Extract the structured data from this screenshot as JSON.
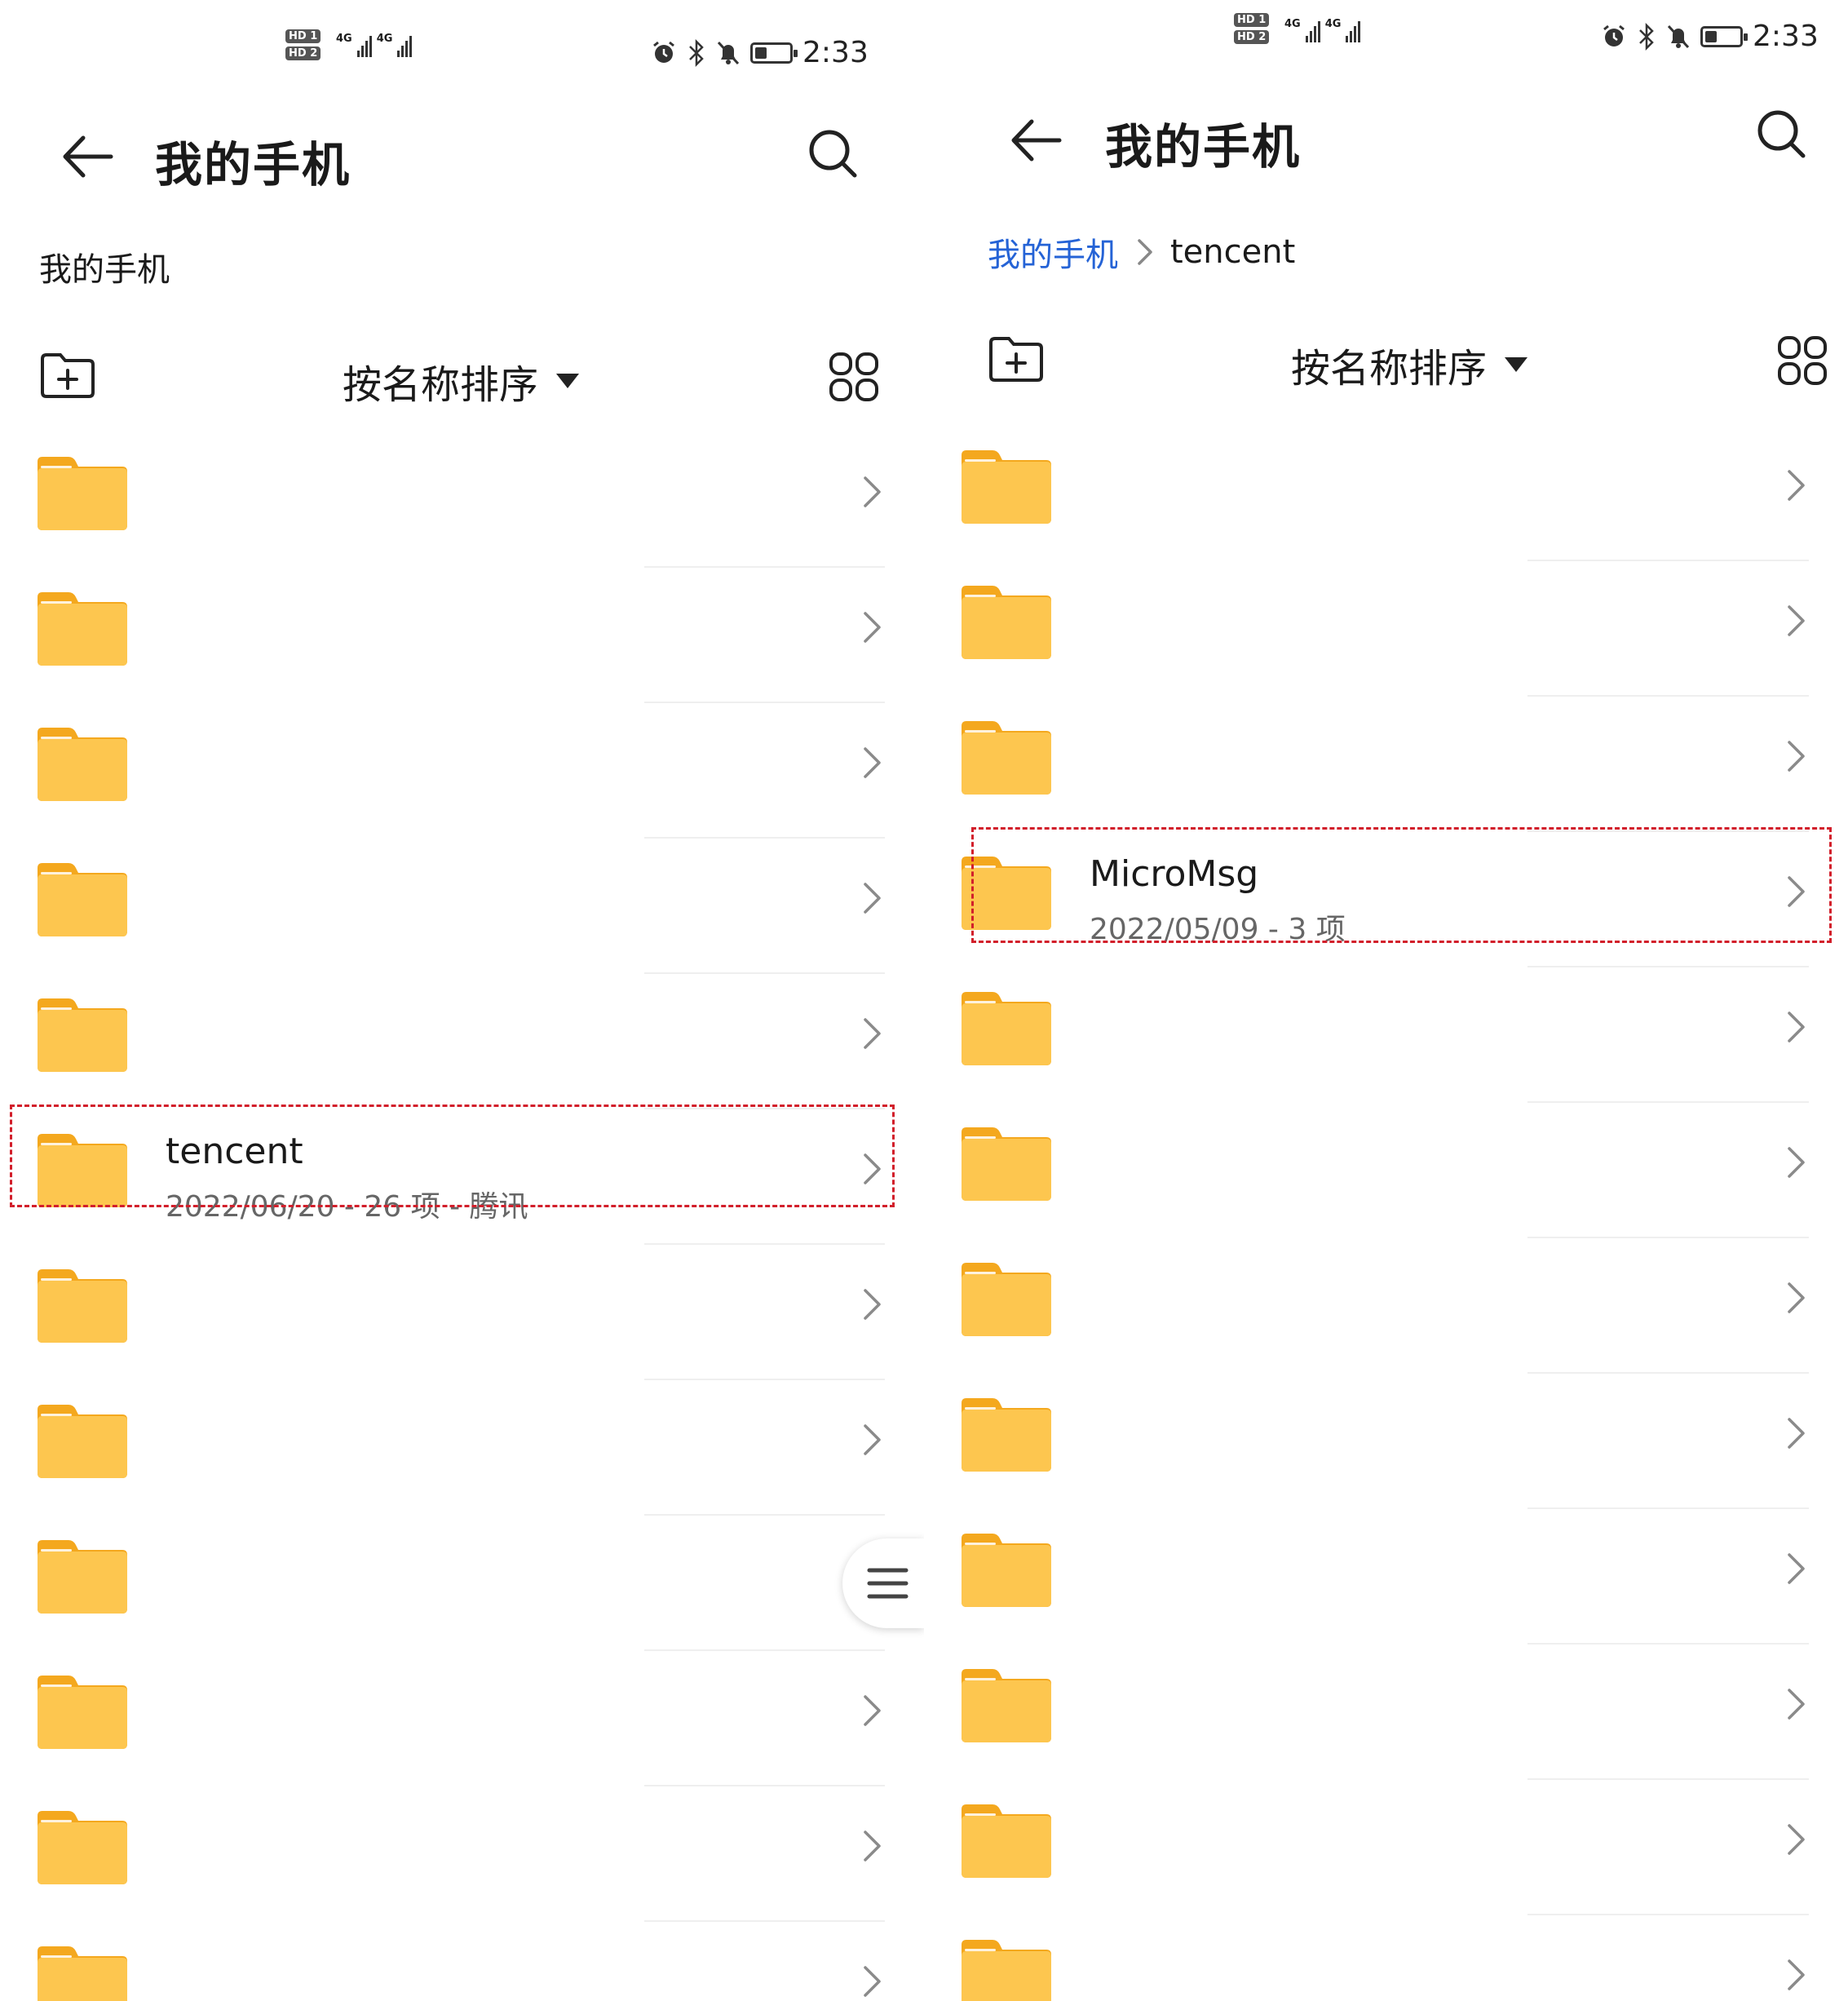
{
  "left": {
    "status": {
      "sim1": "HD 1",
      "sim2": "HD 2",
      "net1": "4G",
      "net2": "4G",
      "time": "2:33",
      "battery_level": 0.3
    },
    "title": "我的手机",
    "path_label": "我的手机",
    "sort_label": "按名称排序",
    "items": [
      {
        "name": "",
        "meta": ""
      },
      {
        "name": "",
        "meta": ""
      },
      {
        "name": "",
        "meta": ""
      },
      {
        "name": "",
        "meta": ""
      },
      {
        "name": "",
        "meta": ""
      },
      {
        "name": "tencent",
        "meta": "2022/06/20 - 26 项 - 腾讯"
      },
      {
        "name": "",
        "meta": ""
      },
      {
        "name": "",
        "meta": ""
      },
      {
        "name": "",
        "meta": ""
      },
      {
        "name": "",
        "meta": ""
      },
      {
        "name": "",
        "meta": ""
      },
      {
        "name": "",
        "meta": ""
      }
    ]
  },
  "right": {
    "status": {
      "sim1": "HD 1",
      "sim2": "HD 2",
      "net1": "4G",
      "net2": "4G",
      "time": "2:33",
      "battery_level": 0.3
    },
    "title": "我的手机",
    "breadcrumb": {
      "root": "我的手机",
      "current": "tencent"
    },
    "sort_label": "按名称排序",
    "items": [
      {
        "name": "",
        "meta": ""
      },
      {
        "name": "",
        "meta": ""
      },
      {
        "name": "",
        "meta": ""
      },
      {
        "name": "MicroMsg",
        "meta": "2022/05/09 - 3 项"
      },
      {
        "name": "",
        "meta": ""
      },
      {
        "name": "",
        "meta": ""
      },
      {
        "name": "",
        "meta": ""
      },
      {
        "name": "",
        "meta": ""
      },
      {
        "name": "",
        "meta": ""
      },
      {
        "name": "",
        "meta": ""
      },
      {
        "name": "",
        "meta": ""
      },
      {
        "name": "",
        "meta": ""
      }
    ]
  },
  "colors": {
    "folder": "#fdc64f",
    "folder_tab": "#f4a81e",
    "highlight": "#d21f2b",
    "link": "#2563d6"
  }
}
